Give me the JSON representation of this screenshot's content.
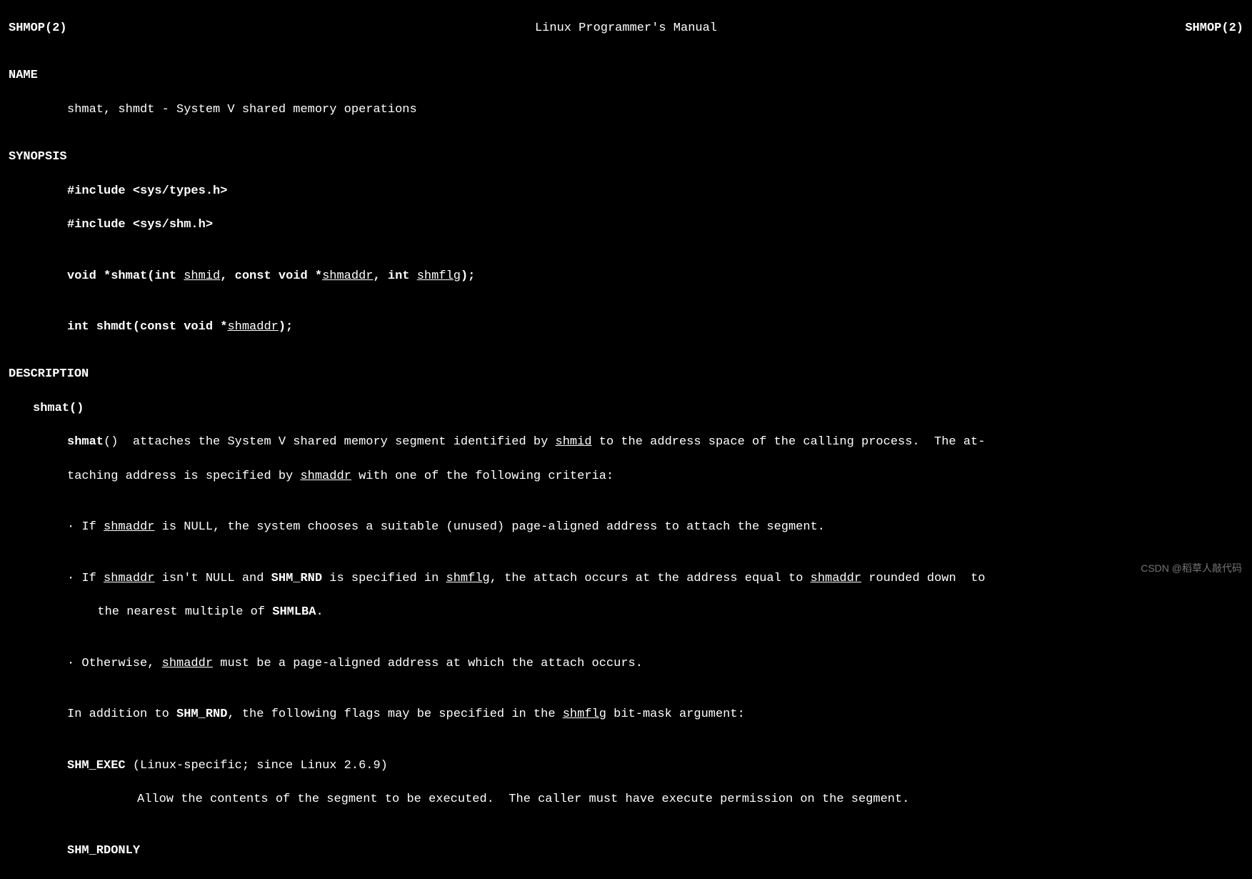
{
  "header": {
    "left": "SHMOP(2)",
    "center": "Linux Programmer's Manual",
    "right": "SHMOP(2)"
  },
  "sections": {
    "name_label": "NAME",
    "name_text": "shmat, shmdt - System V shared memory operations",
    "synopsis_label": "SYNOPSIS",
    "include1": "#include <sys/types.h>",
    "include2": "#include <sys/shm.h>",
    "proto1_a": "void *shmat(int ",
    "proto1_shmid": "shmid",
    "proto1_b": ", const void *",
    "proto1_shmaddr": "shmaddr",
    "proto1_c": ", int ",
    "proto1_shmflg": "shmflg",
    "proto1_d": ");",
    "proto2_a": "int shmdt(const void *",
    "proto2_shmaddr": "shmaddr",
    "proto2_b": ");",
    "description_label": "DESCRIPTION",
    "shmat_sub": "shmat()",
    "desc_p1_a": "shmat",
    "desc_p1_b": "()  attaches the System V shared memory segment identified by ",
    "desc_p1_shmid": "shmid",
    "desc_p1_c": " to the address space of the calling process.  The at‐",
    "desc_p1_line2a": "taching address is specified by ",
    "desc_p1_line2_shmaddr": "shmaddr",
    "desc_p1_line2b": " with one of the following criteria:",
    "bullet1_a": "· If ",
    "bullet1_shmaddr": "shmaddr",
    "bullet1_b": " is NULL, the system chooses a suitable (unused) page-aligned address to attach the segment.",
    "bullet2_a": "· If ",
    "bullet2_shmaddr": "shmaddr",
    "bullet2_b": " isn't NULL and ",
    "bullet2_shmrnd": "SHM_RND",
    "bullet2_c": " is specified in ",
    "bullet2_shmflg": "shmflg",
    "bullet2_d": ", the attach occurs at the address equal to ",
    "bullet2_shmaddr2": "shmaddr",
    "bullet2_e": " rounded down  to",
    "bullet2_line2a": "  the nearest multiple of ",
    "bullet2_shmlba": "SHMLBA",
    "bullet2_line2b": ".",
    "bullet3_a": "· Otherwise, ",
    "bullet3_shmaddr": "shmaddr",
    "bullet3_b": " must be a page-aligned address at which the attach occurs.",
    "addl_a": "In addition to ",
    "addl_shmrnd": "SHM_RND",
    "addl_b": ", the following flags may be specified in the ",
    "addl_shmflg": "shmflg",
    "addl_c": " bit-mask argument:",
    "shmexec_label": "SHM_EXEC",
    "shmexec_note": " (Linux-specific; since Linux 2.6.9)",
    "shmexec_desc": "Allow the contents of the segment to be executed.  The caller must have execute permission on the segment.",
    "shmrdonly_label": "SHM_RDONLY"
  },
  "watermark": "CSDN @稻草人敲代码"
}
